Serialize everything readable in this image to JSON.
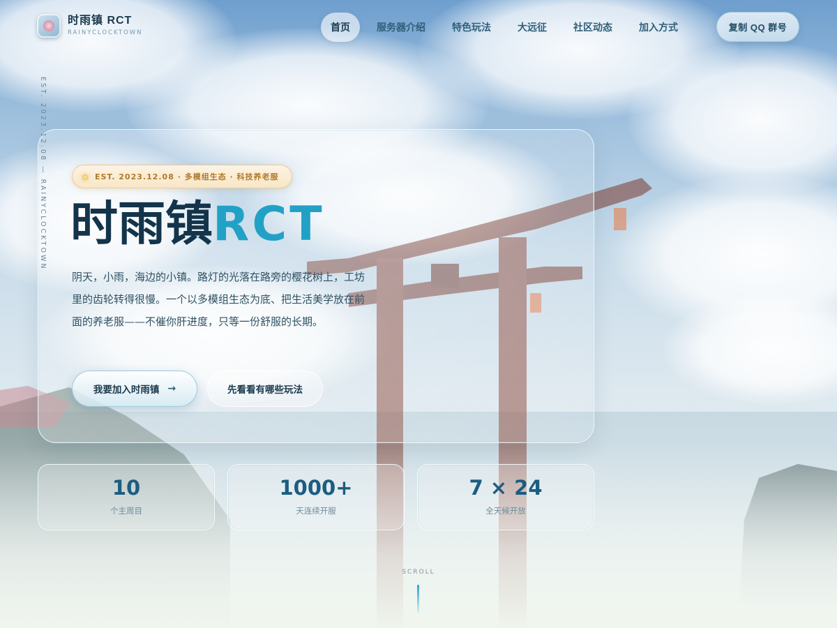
{
  "brand": {
    "name": "时雨镇 RCT",
    "subtitle": "RAINYCLOCKTOWN",
    "logo_icon": "sakura-logo-icon"
  },
  "nav": {
    "items": [
      {
        "label": "首页",
        "active": true
      },
      {
        "label": "服务器介绍",
        "active": false
      },
      {
        "label": "特色玩法",
        "active": false
      },
      {
        "label": "大远征",
        "active": false
      },
      {
        "label": "社区动态",
        "active": false
      },
      {
        "label": "加入方式",
        "active": false
      }
    ],
    "qq_button": "复制 QQ 群号"
  },
  "side_text": "EST. 2023.12.08 — RAINYCLOCKTOWN",
  "hero": {
    "badge": "EST. 2023.12.08 · 多模组生态 · 科技养老服",
    "title_cn": "时雨镇",
    "title_en": "RCT",
    "description": "阴天，小雨，海边的小镇。路灯的光落在路旁的樱花树上，工坊里的齿轮转得很慢。一个以多模组生态为底、把生活美学放在前面的养老服——不催你肝进度，只等一份舒服的长期。",
    "primary_button": "我要加入时雨镇",
    "primary_button_icon": "→",
    "secondary_button": "先看看有哪些玩法"
  },
  "stats": [
    {
      "value": "10",
      "label": "个主周目"
    },
    {
      "value": "1000+",
      "label": "天连续开服"
    },
    {
      "value": "7 × 24",
      "label": "全天候开放"
    }
  ],
  "scroll": {
    "label": "SCROLL"
  },
  "colors": {
    "accent": "#22a1c6",
    "title_dark": "#13344a",
    "badge_gold": "#b07a2a"
  }
}
